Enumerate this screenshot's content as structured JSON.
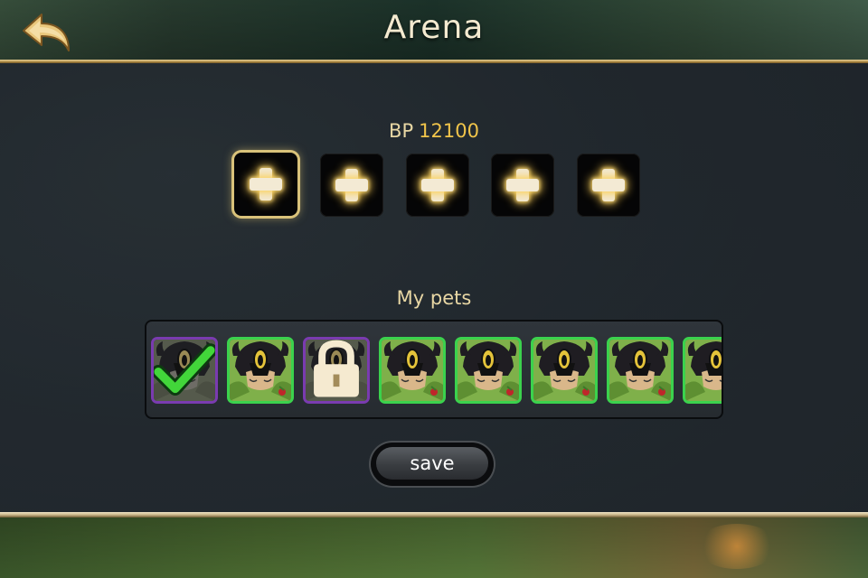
{
  "header": {
    "title": "Arena",
    "back_icon": "back-arrow-icon"
  },
  "team": {
    "bp_label": "BP",
    "bp_value": "12100",
    "slot_count": 5,
    "selected_slot": 1,
    "slot_icon": "plus-icon"
  },
  "pets": {
    "label": "My pets",
    "items": [
      {
        "frame": "purple",
        "status": "selected",
        "status_icon": "checkmark-icon",
        "dimmed": true
      },
      {
        "frame": "green",
        "status": "available",
        "dimmed": false
      },
      {
        "frame": "purple",
        "status": "locked",
        "status_icon": "lock-icon",
        "dimmed": true
      },
      {
        "frame": "green",
        "status": "available",
        "dimmed": false
      },
      {
        "frame": "green",
        "status": "available",
        "dimmed": false
      },
      {
        "frame": "green",
        "status": "available",
        "dimmed": false
      },
      {
        "frame": "green",
        "status": "available",
        "dimmed": false
      },
      {
        "frame": "green",
        "status": "available",
        "dimmed": false
      }
    ]
  },
  "actions": {
    "save_label": "save"
  },
  "colors": {
    "gold_text": "#f0c44a",
    "label_text": "#e8d7a4",
    "green_frame": "#3bd24d",
    "purple_frame": "#7a3bb0"
  }
}
